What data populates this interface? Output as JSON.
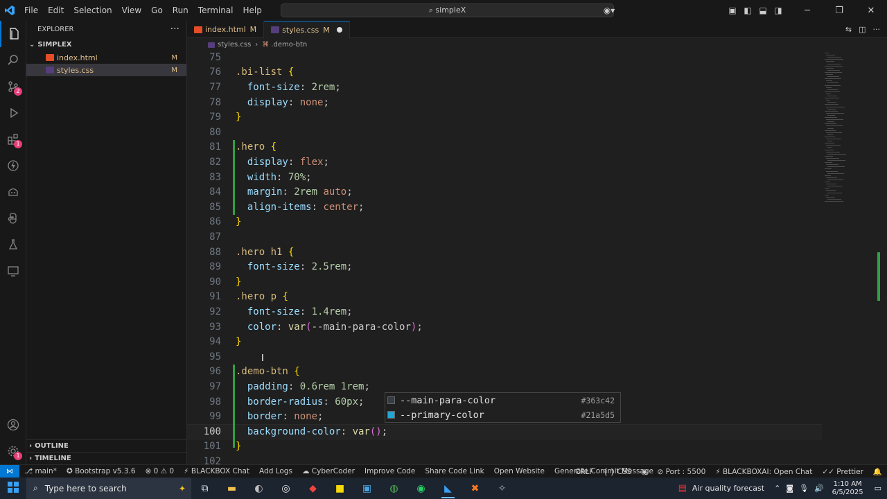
{
  "title_bar": {
    "menu": [
      "File",
      "Edit",
      "Selection",
      "View",
      "Go",
      "Run",
      "Terminal",
      "Help"
    ],
    "search_text": "simpleX"
  },
  "sidebar": {
    "title": "EXPLORER",
    "folder": "SIMPLEX",
    "files": [
      {
        "name": "index.html",
        "status": "M",
        "icon_color": "#e44d26"
      },
      {
        "name": "styles.css",
        "status": "M",
        "icon_color": "#563d7c"
      }
    ],
    "outline": "OUTLINE",
    "timeline": "TIMELINE"
  },
  "tabs": [
    {
      "label": "index.html",
      "status": "M"
    },
    {
      "label": "styles.css",
      "status": "M",
      "dirty": true
    }
  ],
  "breadcrumb": [
    "styles.css",
    ".demo-btn"
  ],
  "editor": {
    "lines": [
      {
        "n": "75",
        "tokens": []
      },
      {
        "n": "76",
        "tokens": [
          [
            "t-sel",
            ".bi-list "
          ],
          [
            "t-brace",
            "{"
          ]
        ]
      },
      {
        "n": "77",
        "tokens": [
          [
            "t-plain",
            "  "
          ],
          [
            "t-prop",
            "font-size"
          ],
          [
            "t-plain",
            ": "
          ],
          [
            "t-num",
            "2"
          ],
          [
            "t-unit",
            "rem"
          ],
          [
            "t-plain",
            ";"
          ]
        ]
      },
      {
        "n": "78",
        "tokens": [
          [
            "t-plain",
            "  "
          ],
          [
            "t-prop",
            "display"
          ],
          [
            "t-plain",
            ": "
          ],
          [
            "t-val",
            "none"
          ],
          [
            "t-plain",
            ";"
          ]
        ]
      },
      {
        "n": "79",
        "tokens": [
          [
            "t-brace",
            "}"
          ]
        ]
      },
      {
        "n": "80",
        "tokens": []
      },
      {
        "n": "81",
        "tokens": [
          [
            "t-sel",
            ".hero "
          ],
          [
            "t-brace",
            "{"
          ]
        ]
      },
      {
        "n": "82",
        "tokens": [
          [
            "t-plain",
            "  "
          ],
          [
            "t-prop",
            "display"
          ],
          [
            "t-plain",
            ": "
          ],
          [
            "t-val",
            "flex"
          ],
          [
            "t-plain",
            ";"
          ]
        ]
      },
      {
        "n": "83",
        "tokens": [
          [
            "t-plain",
            "  "
          ],
          [
            "t-prop",
            "width"
          ],
          [
            "t-plain",
            ": "
          ],
          [
            "t-num",
            "70"
          ],
          [
            "t-unit",
            "%"
          ],
          [
            "t-plain",
            ";"
          ]
        ]
      },
      {
        "n": "84",
        "tokens": [
          [
            "t-plain",
            "  "
          ],
          [
            "t-prop",
            "margin"
          ],
          [
            "t-plain",
            ": "
          ],
          [
            "t-num",
            "2"
          ],
          [
            "t-unit",
            "rem"
          ],
          [
            "t-val",
            " auto"
          ],
          [
            "t-plain",
            ";"
          ]
        ]
      },
      {
        "n": "85",
        "tokens": [
          [
            "t-plain",
            "  "
          ],
          [
            "t-prop",
            "align-items"
          ],
          [
            "t-plain",
            ": "
          ],
          [
            "t-val",
            "center"
          ],
          [
            "t-plain",
            ";"
          ]
        ]
      },
      {
        "n": "86",
        "tokens": [
          [
            "t-brace",
            "}"
          ]
        ]
      },
      {
        "n": "87",
        "tokens": []
      },
      {
        "n": "88",
        "tokens": [
          [
            "t-sel",
            ".hero "
          ],
          [
            "t-tag",
            "h1 "
          ],
          [
            "t-brace",
            "{"
          ]
        ]
      },
      {
        "n": "89",
        "tokens": [
          [
            "t-plain",
            "  "
          ],
          [
            "t-prop",
            "font-size"
          ],
          [
            "t-plain",
            ": "
          ],
          [
            "t-num",
            "2.5"
          ],
          [
            "t-unit",
            "rem"
          ],
          [
            "t-plain",
            ";"
          ]
        ]
      },
      {
        "n": "90",
        "tokens": [
          [
            "t-brace",
            "}"
          ]
        ]
      },
      {
        "n": "91",
        "tokens": [
          [
            "t-sel",
            ".hero "
          ],
          [
            "t-tag",
            "p "
          ],
          [
            "t-brace",
            "{"
          ]
        ]
      },
      {
        "n": "92",
        "tokens": [
          [
            "t-plain",
            "  "
          ],
          [
            "t-prop",
            "font-size"
          ],
          [
            "t-plain",
            ": "
          ],
          [
            "t-num",
            "1.4"
          ],
          [
            "t-unit",
            "rem"
          ],
          [
            "t-plain",
            ";"
          ]
        ]
      },
      {
        "n": "93",
        "tokens": [
          [
            "t-plain",
            "  "
          ],
          [
            "t-prop",
            "color"
          ],
          [
            "t-plain",
            ": "
          ],
          [
            "t-fn",
            "var"
          ],
          [
            "t-paren",
            "("
          ],
          [
            "t-plain",
            "--main-para-color"
          ],
          [
            "t-paren",
            ")"
          ],
          [
            "t-plain",
            ";"
          ]
        ]
      },
      {
        "n": "94",
        "tokens": [
          [
            "t-brace",
            "}"
          ]
        ]
      },
      {
        "n": "95",
        "tokens": []
      },
      {
        "n": "96",
        "tokens": [
          [
            "t-sel",
            ".demo-btn "
          ],
          [
            "t-brace",
            "{"
          ]
        ]
      },
      {
        "n": "97",
        "tokens": [
          [
            "t-plain",
            "  "
          ],
          [
            "t-prop",
            "padding"
          ],
          [
            "t-plain",
            ": "
          ],
          [
            "t-num",
            "0.6"
          ],
          [
            "t-unit",
            "rem"
          ],
          [
            "t-plain",
            " "
          ],
          [
            "t-num",
            "1"
          ],
          [
            "t-unit",
            "rem"
          ],
          [
            "t-plain",
            ";"
          ]
        ]
      },
      {
        "n": "98",
        "tokens": [
          [
            "t-plain",
            "  "
          ],
          [
            "t-prop",
            "border-radius"
          ],
          [
            "t-plain",
            ": "
          ],
          [
            "t-num",
            "60"
          ],
          [
            "t-unit",
            "px"
          ],
          [
            "t-plain",
            ";"
          ]
        ]
      },
      {
        "n": "99",
        "tokens": [
          [
            "t-plain",
            "  "
          ],
          [
            "t-prop",
            "border"
          ],
          [
            "t-plain",
            ": "
          ],
          [
            "t-val",
            "none"
          ],
          [
            "t-plain",
            ";"
          ]
        ]
      },
      {
        "n": "100",
        "tokens": [
          [
            "t-plain",
            "  "
          ],
          [
            "t-prop",
            "background-color"
          ],
          [
            "t-plain",
            ": "
          ],
          [
            "t-fn",
            "var"
          ],
          [
            "t-paren",
            "()"
          ],
          [
            "t-plain",
            ";"
          ]
        ]
      },
      {
        "n": "101",
        "tokens": [
          [
            "t-brace",
            "}"
          ]
        ]
      },
      {
        "n": "102",
        "tokens": []
      }
    ],
    "current_line": "100"
  },
  "suggestions": [
    {
      "label": "--main-para-color",
      "detail": "#363c42",
      "swatch": "#363c42"
    },
    {
      "label": "--primary-color",
      "detail": "#21a5d5",
      "swatch": "#21a5d5"
    }
  ],
  "status_bar": {
    "left": [
      "main*",
      "Bootstrap v5.3.6",
      "⊗ 0 ⚠ 0",
      "BLACKBOX Chat",
      "Add Logs",
      "CyberCoder",
      "Improve Code",
      "Share Code Link",
      "Open Website",
      "Generate Commit Message"
    ],
    "right": [
      "CRLF",
      "CSS",
      "Port : 5500",
      "BLACKBOXAI: Open Chat",
      "Prettier"
    ]
  },
  "taskbar": {
    "search_placeholder": "Type here to search",
    "weather": "Air quality forecast",
    "time": "1:10 AM",
    "date": "6/5/2025"
  }
}
